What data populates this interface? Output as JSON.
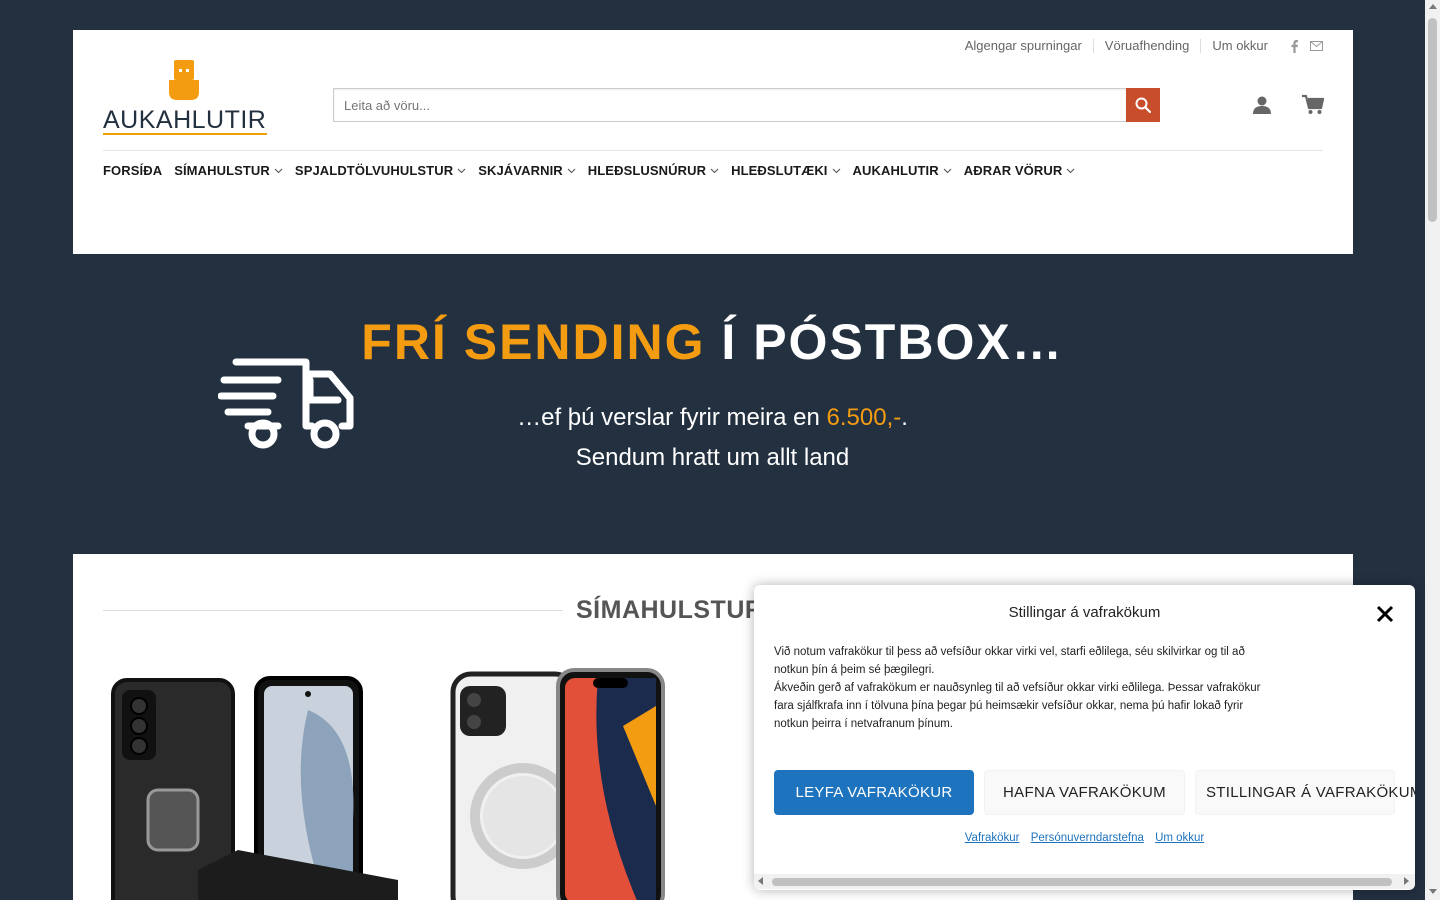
{
  "topbar": {
    "links": [
      "Algengar spurningar",
      "Vöruafhending",
      "Um okkur"
    ],
    "icons": [
      "facebook-icon",
      "envelope-icon"
    ]
  },
  "logo": {
    "text": "AUKAHLUTIR",
    "accent": "#f39c12"
  },
  "search": {
    "placeholder": "Leita að vöru...",
    "button_color": "#c84d2a"
  },
  "nav": {
    "items": [
      {
        "label": "FORSÍÐA",
        "has_dropdown": false
      },
      {
        "label": "SÍMAHULSTUR",
        "has_dropdown": true
      },
      {
        "label": "SPJALDTÖLVUHULSTUR",
        "has_dropdown": true
      },
      {
        "label": "SKJÁVARNIR",
        "has_dropdown": true
      },
      {
        "label": "HLEÐSLUSNÚRUR",
        "has_dropdown": true
      },
      {
        "label": "HLEÐSLUTÆKI",
        "has_dropdown": true
      },
      {
        "label": "AUKAHLUTIR",
        "has_dropdown": true
      },
      {
        "label": "AÐRAR VÖRUR",
        "has_dropdown": true
      }
    ]
  },
  "banner": {
    "title_highlight": "FRÍ SENDING",
    "title_rest": " Í PÓSTBOX…",
    "sub_before": "…ef þú verslar fyrir meira en ",
    "sub_amount": "6.500,-",
    "sub_after": ".",
    "sub_line2": "Sendum hratt um allt land"
  },
  "section": {
    "title": "SÍMAHULSTUR"
  },
  "cookie": {
    "title": "Stillingar á vafrakökum",
    "text1": "Við notum vafrakökur til þess að vefsíður okkar virki vel, starfi eðlilega, séu skilvirkar og til að notkun þín á þeim sé þægilegri.",
    "text2": "Ákveðin gerð af vafrakökum er nauðsynleg til að vefsíður okkar virki eðlilega. Þessar vafrakökur fara sjálfkrafa inn í tölvuna þína þegar þú heimsækir vefsíður okkar, nema þú hafir lokað fyrir notkun þeirra í netvafranum þínum.",
    "accept": "LEYFA VAFRAKÖKUR",
    "deny": "HAFNA VAFRAKÖKUM",
    "prefs": "STILLINGAR Á VAFRAKÖKUM",
    "links": [
      "Vafrakökur",
      "Persónuverndarstefna",
      "Um okkur"
    ]
  }
}
